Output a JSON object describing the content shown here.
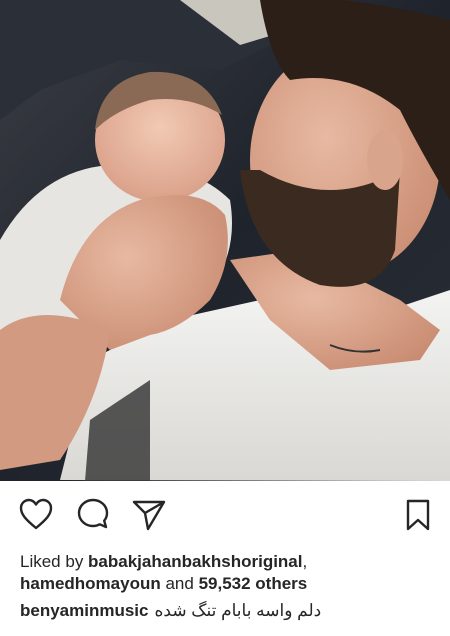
{
  "post": {
    "image_alt": "Man with beard holding sleeping newborn baby against his chest"
  },
  "actions": {
    "like_icon": "heart-icon",
    "comment_icon": "comment-bubble-icon",
    "share_icon": "paper-plane-icon",
    "save_icon": "bookmark-icon"
  },
  "likes": {
    "prefix": "Liked by ",
    "user1": "babakjahanbakhshoriginal",
    "separator": ",",
    "user2": "hamedhomayoun",
    "middle": " and ",
    "count": "59,532 others"
  },
  "caption": {
    "username": "benyaminmusic",
    "text": "دلم واسه بابام تنگ شده"
  },
  "colors": {
    "text": "#262626",
    "icon": "#262626",
    "background": "#ffffff"
  }
}
